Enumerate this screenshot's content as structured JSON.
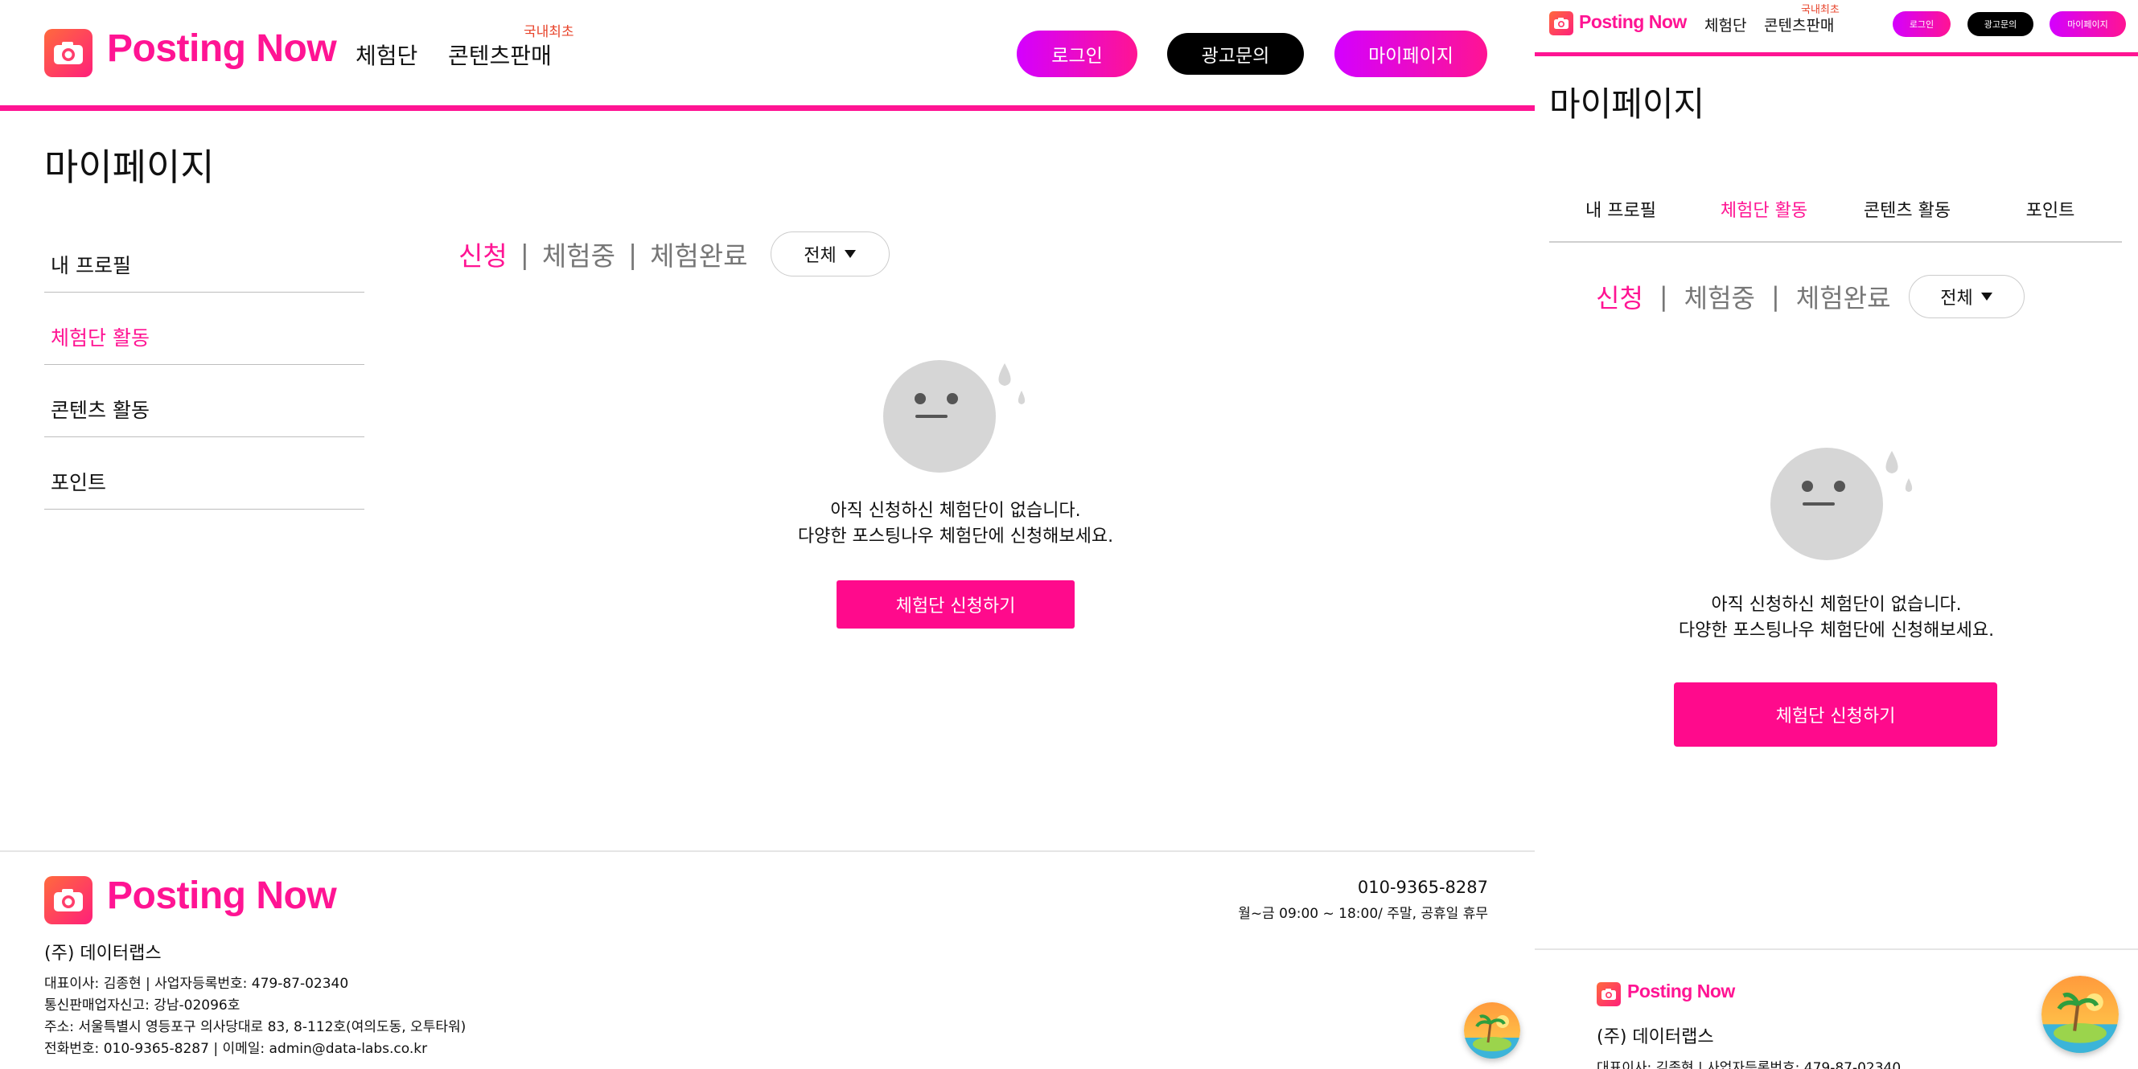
{
  "brand": {
    "name": "Posting Now",
    "color": "#ff1493",
    "accent_gradient": [
      "#d400ff",
      "#ff1493"
    ],
    "logo_icon": "camera-icon"
  },
  "nav": {
    "items": [
      {
        "label": "체험단"
      },
      {
        "label": "콘텐츠판매",
        "badge": "국내최초"
      }
    ]
  },
  "header_buttons": {
    "login": "로그인",
    "ad_inquiry": "광고문의",
    "mypage": "마이페이지"
  },
  "page": {
    "title": "마이페이지"
  },
  "sidebar": {
    "items": [
      {
        "label": "내 프로필",
        "active": false
      },
      {
        "label": "체험단 활동",
        "active": true
      },
      {
        "label": "콘텐츠 활동",
        "active": false
      },
      {
        "label": "포인트",
        "active": false
      }
    ]
  },
  "filters": {
    "tabs": [
      "신청",
      "체험중",
      "체험완료"
    ],
    "active_tab": "신청",
    "separator": "|",
    "select_value": "전체"
  },
  "empty_state": {
    "icon": "sad-face-icon",
    "line1": "아직 신청하신 체험단이 없습니다.",
    "line2": "다양한 포스팅나우 체험단에 신청해보세요.",
    "cta": "체험단 신청하기"
  },
  "footer": {
    "company": "(주) 데이터랩스",
    "ceo_line": "대표이사: 김종현 | 사업자등록번호: 479-87-02340",
    "ecommerce_line": "통신판매업자신고: 강남-02096호",
    "address_line": "주소: 서울특별시 영등포구 의사당대로 83, 8-112호(여의도동, 오투타워)",
    "contact_line": "전화번호: 010-9365-8287 | 이메일: admin@data-labs.co.kr",
    "phone": "010-9365-8287",
    "hours": "월~금 09:00 ~ 18:00/ 주말, 공휴일 휴무",
    "floating_icon": "island-beach-icon"
  }
}
